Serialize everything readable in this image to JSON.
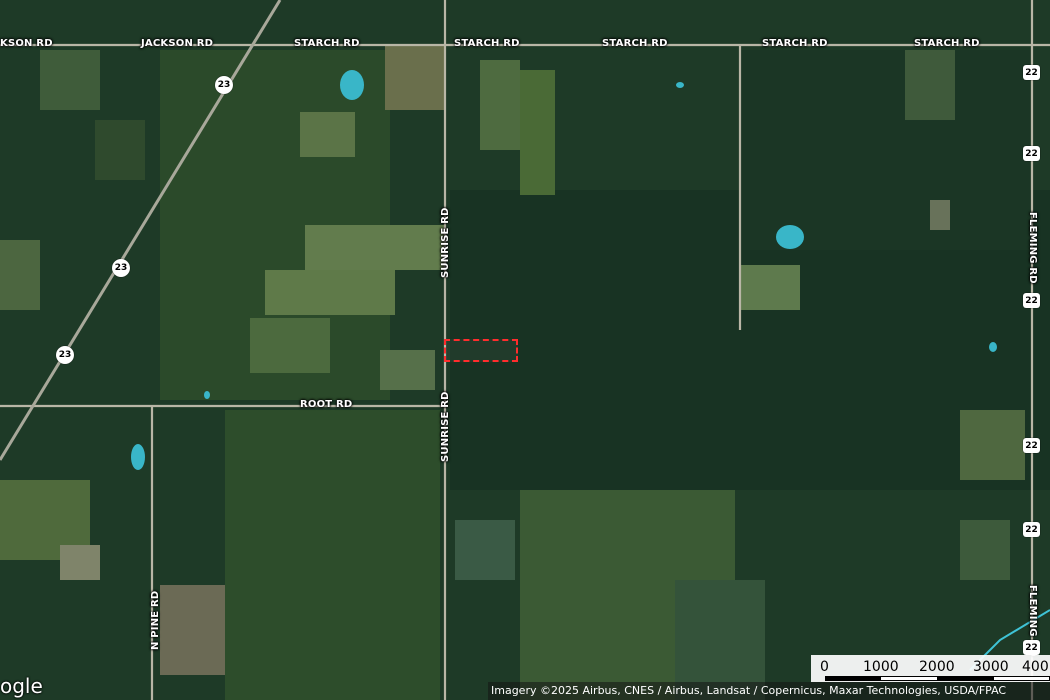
{
  "roads": {
    "jackson_rd_1": "KSON RD",
    "jackson_rd_2": "JACKSON RD",
    "starch_rd": [
      "STARCH RD",
      "STARCH RD",
      "STARCH RD",
      "STARCH RD",
      "STARCH RD"
    ],
    "root_rd": "ROOT RD",
    "sunrise_rd": [
      "SUNRISE RD",
      "SUNRISE RD"
    ],
    "fleming_rd": [
      "FLEMING RD",
      "FLEMING RD"
    ],
    "n_pine_rd": "N PINE RD"
  },
  "shields": {
    "route_23": [
      "23",
      "23",
      "23"
    ],
    "route_22": [
      "22",
      "22",
      "22",
      "22",
      "22",
      "22"
    ]
  },
  "logo_text": "ogle",
  "attribution": "Imagery ©2025 Airbus, CNES / Airbus, Landsat / Copernicus, Maxar Technologies, USDA/FPAC",
  "scale": {
    "labels": [
      "0",
      "1000",
      "2000",
      "3000",
      "400"
    ]
  },
  "colors": {
    "parcel_outline": "#ff2d2d",
    "water": "#39b6c8"
  }
}
